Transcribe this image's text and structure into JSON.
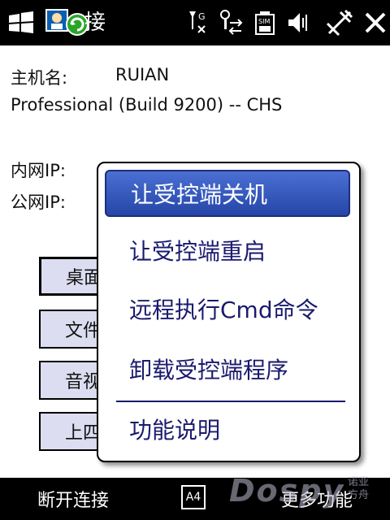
{
  "status_bar": {
    "app_title": "接",
    "icons": [
      "windows-start-icon",
      "app-icon",
      "signal-icon",
      "data-sync-icon",
      "battery-icon",
      "volume-icon",
      "connectivity-icon",
      "close-icon"
    ]
  },
  "info": {
    "host_label": "主机名:",
    "host_value": "RUIAN",
    "os_line": "Professional  (Build 9200) -- CHS",
    "lan_label": "内网IP:",
    "wan_label": "公网IP:"
  },
  "buttons": [
    "桌面",
    "文件",
    "音视",
    "上四"
  ],
  "context_menu": {
    "items": [
      "让受控端关机",
      "让受控端重启",
      "远程执行Cmd命令",
      "卸载受控端程序",
      "功能说明"
    ],
    "selected_index": 0
  },
  "bottom_bar": {
    "left_softkey": "断开连接",
    "input_indicator": "A4",
    "right_softkey": "更多功能"
  },
  "watermark": {
    "text": "Dospy",
    "sub_line1": "诺亚",
    "sub_line2": "方舟"
  }
}
